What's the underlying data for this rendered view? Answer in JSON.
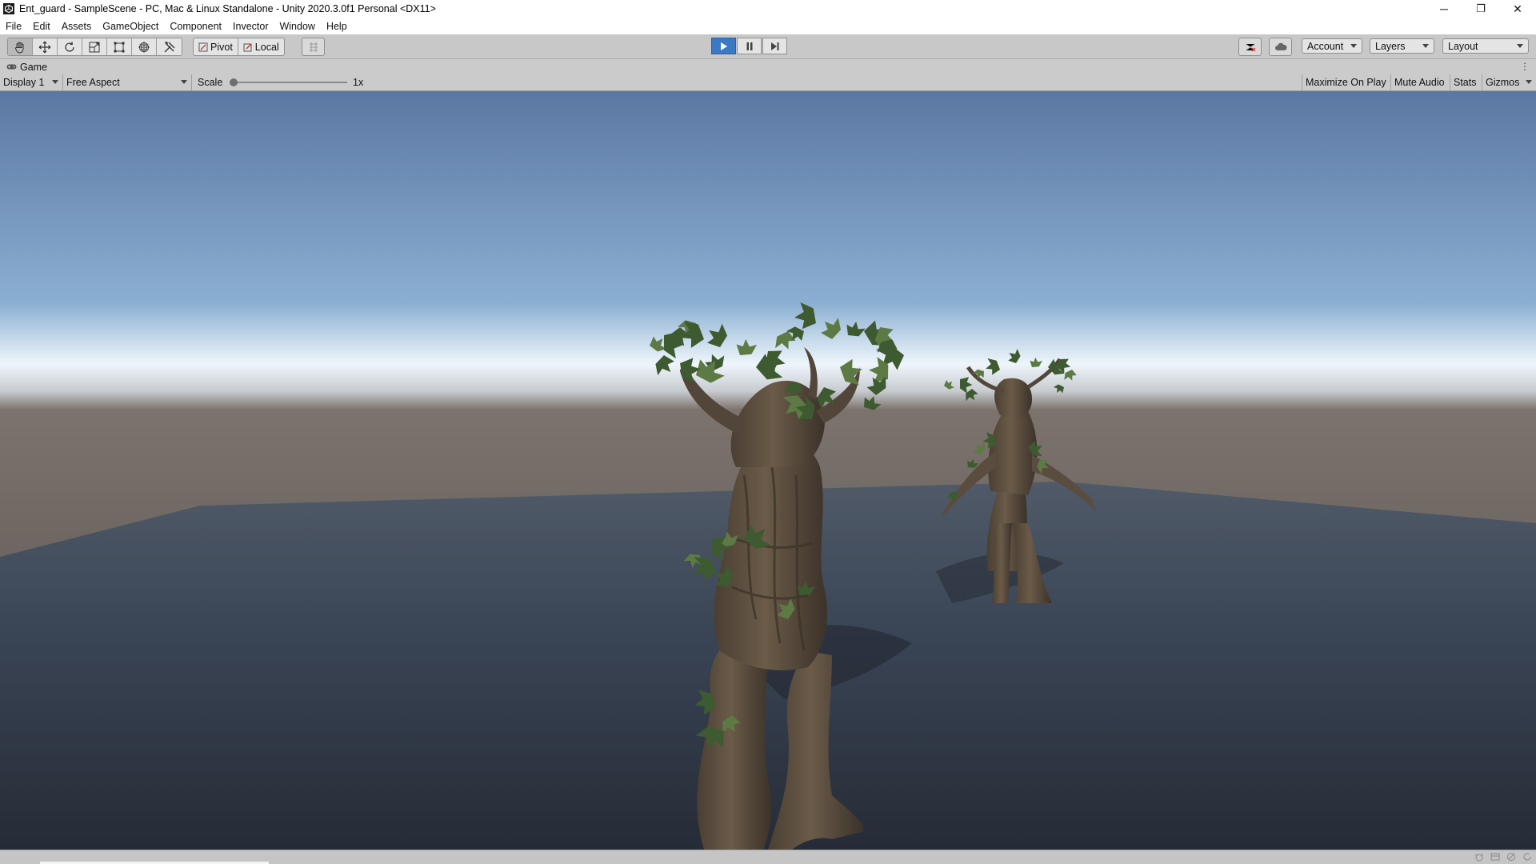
{
  "window": {
    "title": "Ent_guard - SampleScene - PC, Mac & Linux Standalone - Unity 2020.3.0f1 Personal <DX11>",
    "controls": {
      "minimize": "─",
      "restore": "❐",
      "close": "✕"
    }
  },
  "menu": [
    "File",
    "Edit",
    "Assets",
    "GameObject",
    "Component",
    "Invector",
    "Window",
    "Help"
  ],
  "toolbar": {
    "tools": [
      {
        "name": "hand-tool",
        "icon": "hand-icon",
        "active": true
      },
      {
        "name": "move-tool",
        "icon": "move-icon",
        "active": false
      },
      {
        "name": "rotate-tool",
        "icon": "rotate-icon",
        "active": false
      },
      {
        "name": "scale-tool",
        "icon": "scale-icon",
        "active": false
      },
      {
        "name": "rect-tool",
        "icon": "rect-icon",
        "active": false
      },
      {
        "name": "transform-tool",
        "icon": "transform-icon",
        "active": false
      },
      {
        "name": "custom-tool",
        "icon": "tools-icon",
        "active": false
      }
    ],
    "pivot_label": "Pivot",
    "local_label": "Local",
    "play_state": "playing",
    "account_label": "Account",
    "layers_label": "Layers",
    "layout_label": "Layout"
  },
  "game_tab": {
    "label": "Game"
  },
  "game_toolbar": {
    "display": "Display 1",
    "aspect": "Free Aspect",
    "scale_label": "Scale",
    "scale_value": "1x",
    "scale_fraction": 0,
    "maximize_on_play": "Maximize On Play",
    "mute_audio": "Mute Audio",
    "stats": "Stats",
    "gizmos": "Gizmos"
  },
  "scene": {
    "sky_top": "#5b77a3",
    "sky_mid": "#8bafd2",
    "horizon": "#eef5fb",
    "ground_far": "#7c736d",
    "plane_color": "#3a4556",
    "bark_color": "#6b5b48",
    "leaf_color": "#3e5a30"
  },
  "colors": {
    "accent": "#3b79c4"
  }
}
